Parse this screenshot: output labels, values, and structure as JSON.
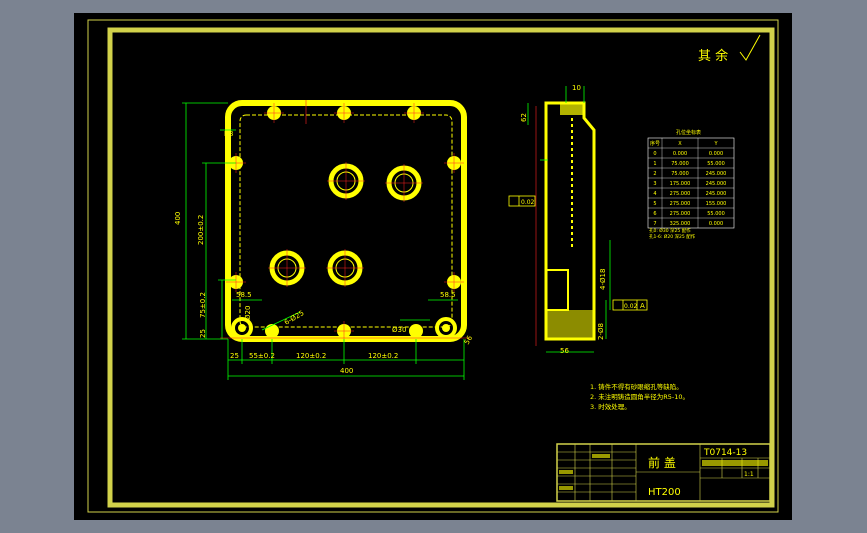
{
  "colors": {
    "viewport_bg": "#7b8391",
    "sheet_bg": "#000000",
    "border": "#d2d24a",
    "part": "#ffff00",
    "dimension": "#00ff00",
    "centerline": "#ff2020",
    "text": "#ffff00",
    "table_line": "#ffffff"
  },
  "title_block": {
    "part_name": "前 盖",
    "material": "HT200",
    "drawing_number": "T0714-13",
    "scale": "1:1"
  },
  "roughness_note": "其 余",
  "notes": [
    "1. 铸件不得有砂眼缩孔等缺陷。",
    "2. 未注明铸造圆角半径为R5-10。",
    "3. 时效处理。"
  ],
  "front_view_dims": {
    "overall_width": "400",
    "overall_height": "400",
    "offset_25_h": "25",
    "pitch_55": "55±0.2",
    "pitch_120_a": "120±0.2",
    "pitch_120_b": "120±0.2",
    "height_200": "200±0.2",
    "height_75": "75±0.2",
    "offset_25_v": "25",
    "offset_56": "56",
    "small_58": "58.5",
    "small_585": "58.5",
    "corner_r": "R8",
    "hole_note": "6-Ø25",
    "dia_30": "Ø30",
    "dia_20": "Ø20"
  },
  "side_view_dims": {
    "top_10": "10",
    "thickness_56": "56",
    "h_62": "62",
    "flatness": "0.02",
    "perp_tol": "0.02",
    "datum": "A",
    "vert_a": "4-Ø18",
    "vert_b": "2-Ø8"
  },
  "coord_table": {
    "title": "孔位坐标表",
    "headers": [
      "序号",
      "X",
      "Y"
    ],
    "rows": [
      [
        "0",
        "0.000",
        "0.000"
      ],
      [
        "1",
        "75.000",
        "55.000"
      ],
      [
        "2",
        "75.000",
        "245.000"
      ],
      [
        "3",
        "175.000",
        "245.000"
      ],
      [
        "4",
        "275.000",
        "245.000"
      ],
      [
        "5",
        "275.000",
        "155.000"
      ],
      [
        "6",
        "275.000",
        "55.000"
      ],
      [
        "7",
        "325.000",
        "0.000"
      ]
    ],
    "note_a": "孔0: Ø30 深25 配作",
    "note_b": "孔1-6: Ø20 深25 配作"
  }
}
